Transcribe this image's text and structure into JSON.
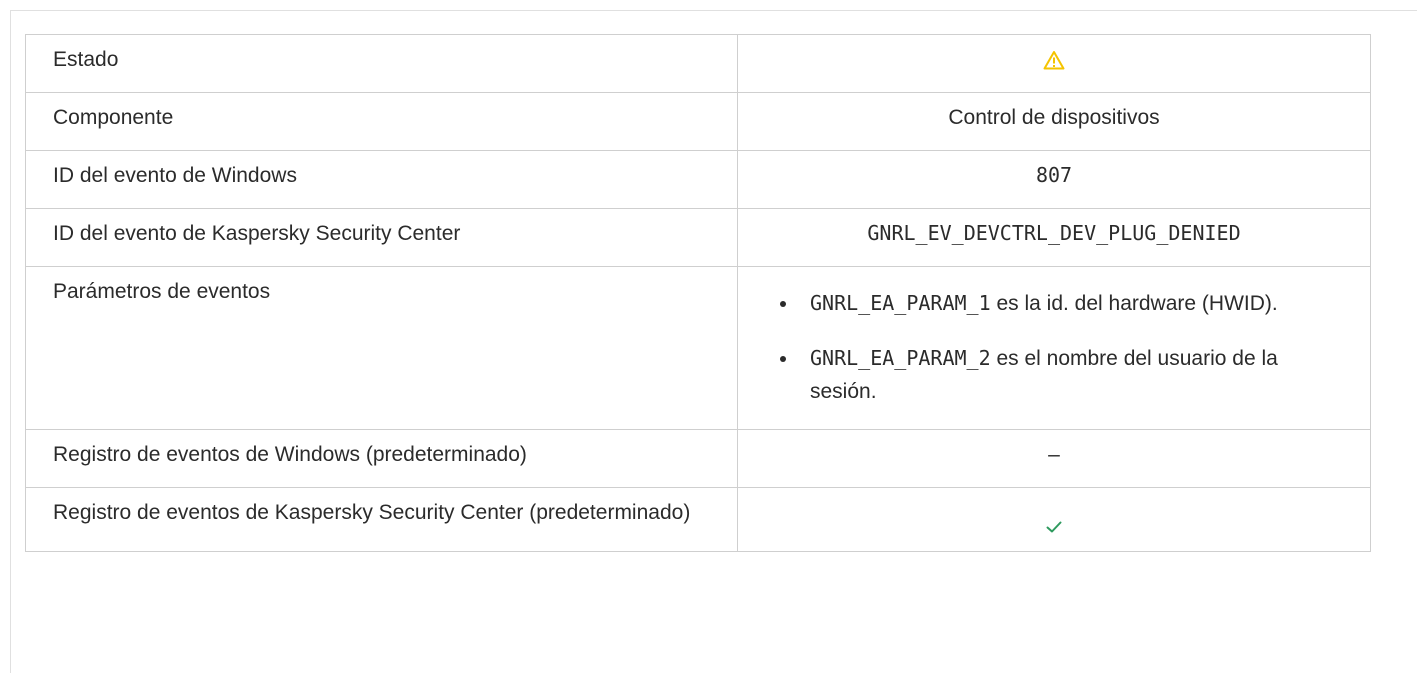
{
  "table": {
    "rows": [
      {
        "label": "Estado",
        "status_icon": "warning-icon",
        "status_color": "#f5c400"
      },
      {
        "label": "Componente",
        "value": "Control de dispositivos"
      },
      {
        "label": "ID del evento de Windows",
        "value": "807"
      },
      {
        "label": "ID del evento de Kaspersky Security Center",
        "value": "GNRL_EV_DEVCTRL_DEV_PLUG_DENIED"
      },
      {
        "label": "Parámetros de eventos",
        "params": [
          {
            "code": "GNRL_EA_PARAM_1",
            "text": " es la id. del hardware (HWID)."
          },
          {
            "code": "GNRL_EA_PARAM_2",
            "text": " es el nombre del usuario de la sesión."
          }
        ]
      },
      {
        "label": "Registro de eventos de Windows (predeterminado)",
        "value": "–"
      },
      {
        "label": "Registro de eventos de Kaspersky Security Center (predeterminado)",
        "status_icon": "checkmark-icon",
        "status_color": "#2e9a5e"
      }
    ]
  }
}
